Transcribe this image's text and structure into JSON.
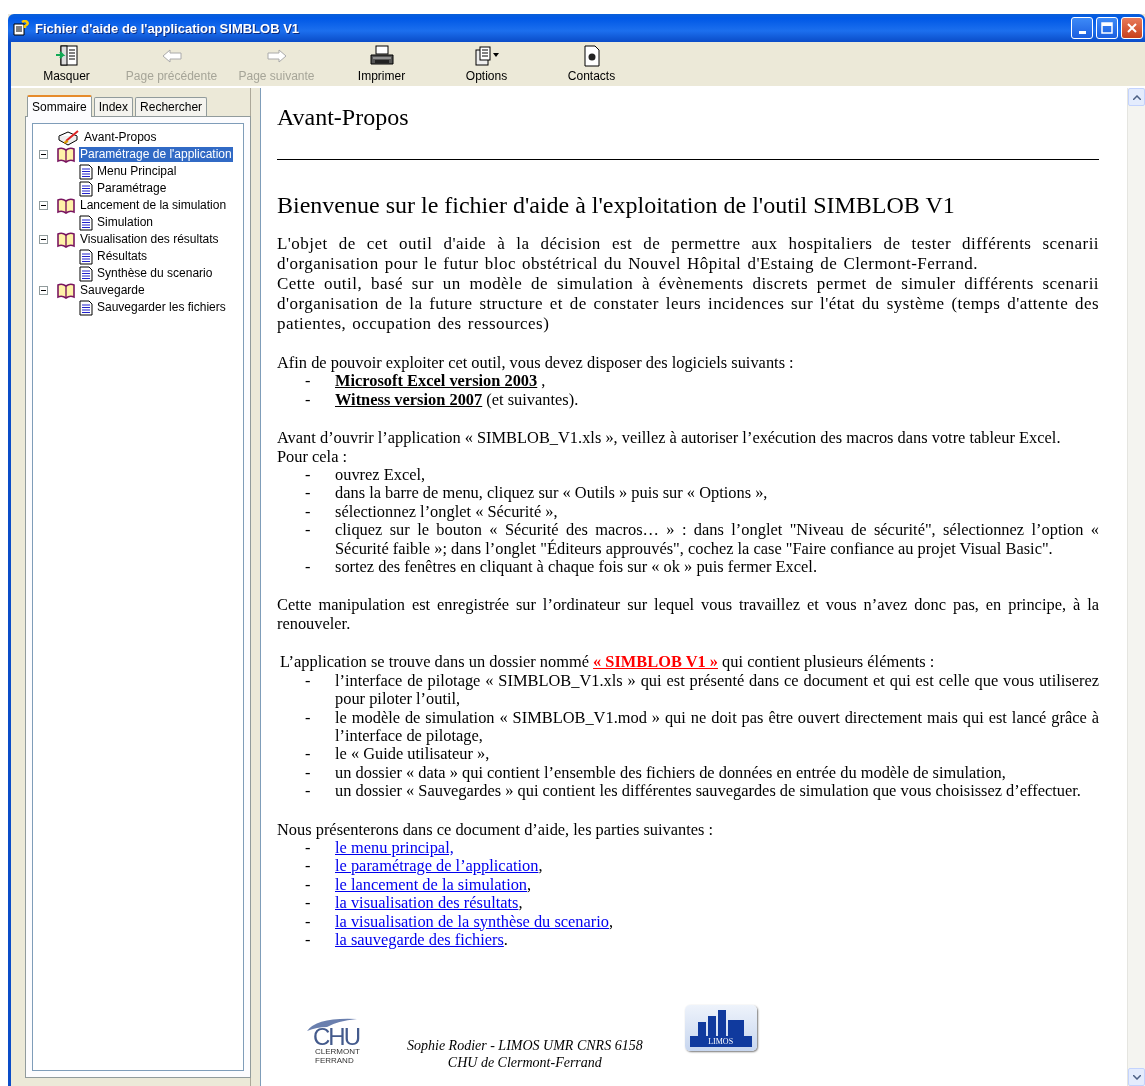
{
  "window": {
    "title": "Fichier d'aide de l'application SIMBLOB V1"
  },
  "toolbar": [
    {
      "label": "Masquer",
      "disabled": false
    },
    {
      "label": "Page précédente",
      "disabled": true
    },
    {
      "label": "Page suivante",
      "disabled": true
    },
    {
      "label": "Imprimer",
      "disabled": false
    },
    {
      "label": "Options",
      "disabled": false
    },
    {
      "label": "Contacts",
      "disabled": false
    }
  ],
  "sidebar": {
    "tabs": [
      {
        "label": "Sommaire",
        "selected": true
      },
      {
        "label": "Index",
        "selected": false
      },
      {
        "label": "Rechercher",
        "selected": false
      }
    ],
    "tree": [
      {
        "label": "Avant-Propos",
        "kind": "note",
        "selected": false
      },
      {
        "label": "Paramétrage de l'application",
        "kind": "book",
        "expanded": true,
        "selected": true,
        "children": [
          {
            "label": "Menu Principal",
            "kind": "page",
            "selected": false
          },
          {
            "label": "Paramétrage",
            "kind": "page",
            "selected": false
          }
        ]
      },
      {
        "label": "Lancement de la simulation",
        "kind": "book",
        "expanded": true,
        "selected": false,
        "children": [
          {
            "label": "Simulation",
            "kind": "page",
            "selected": false
          }
        ]
      },
      {
        "label": "Visualisation des résultats",
        "kind": "book",
        "expanded": true,
        "selected": false,
        "children": [
          {
            "label": "Résultats",
            "kind": "page",
            "selected": false
          },
          {
            "label": "Synthèse du scenario",
            "kind": "page",
            "selected": false
          }
        ]
      },
      {
        "label": "Sauvegarde",
        "kind": "book",
        "expanded": true,
        "selected": false,
        "children": [
          {
            "label": "Sauvegarder les fichiers",
            "kind": "page",
            "selected": false
          }
        ]
      }
    ]
  },
  "content": {
    "heading": "Avant-Propos",
    "title": "Bienvenue sur le fichier d'aide à l'exploitation de l'outil SIMBLOB V1",
    "sections": [
      [
        {
          "kind": "intro",
          "text": "L'objet de cet outil d'aide à la décision est de permettre aux hospitaliers de tester différents scenarii d'organisation pour le futur bloc obstétrical du Nouvel Hôpital d'Estaing de Clermont-Ferrand."
        },
        {
          "kind": "intro",
          "text": "Cette outil, basé sur un modèle de simulation à évènements discrets permet de simuler différents scenarii d'organisation de la future structure et de constater leurs incidences sur l'état du système (temps d'attente des patientes, occupation des ressources)"
        }
      ],
      [
        {
          "kind": "paragraph",
          "text": "Afin de pouvoir exploiter cet outil, vous devez disposer des logiciels suivants :"
        },
        {
          "kind": "bullet",
          "marker": "-",
          "text": "**Microsoft Excel version 2003** ,"
        },
        {
          "kind": "bullet",
          "marker": "-",
          "text": "**Witness version 2007** (et suivantes)."
        }
      ],
      [
        {
          "kind": "paragraph",
          "text": "Avant d’ouvrir l’application « SIMBLOB_V1.xls », veillez à autoriser l’exécution des macros dans votre tableur Excel."
        },
        {
          "kind": "paragraph",
          "text": "Pour cela :"
        },
        {
          "kind": "bullet",
          "marker": "-",
          "text": "ouvrez Excel,"
        },
        {
          "kind": "bullet",
          "marker": "-",
          "text": "dans la barre de menu, cliquez sur « Outils » puis sur « Options »,"
        },
        {
          "kind": "bullet",
          "marker": "-",
          "text": "sélectionnez l’onglet « Sécurité »,"
        },
        {
          "kind": "bullet",
          "marker": "-",
          "text": "cliquez sur le bouton « Sécurité des macros… » : dans l’onglet \"Niveau de sécurité\", sélectionnez l’option « Sécurité faible »; dans l’onglet \"Éditeurs approuvés\", cochez la case \"Faire confiance au projet Visual Basic\"."
        },
        {
          "kind": "bullet",
          "marker": "-",
          "text": "sortez des fenêtres en cliquant à chaque fois sur « ok » puis fermer Excel."
        }
      ],
      [
        {
          "kind": "paragraph",
          "text": "Cette manipulation est enregistrée sur l’ordinateur sur lequel vous travaillez et vous n’avez donc pas, en principe, à la renouveler."
        }
      ],
      [
        {
          "kind": "link_paragraph",
          "before": "L’application se trouve dans un dossier nommé",
          "link": "« SIMBLOB V1 »",
          "after": "qui contient plusieurs éléments :"
        },
        {
          "kind": "bullet",
          "marker": "-",
          "text": "l’interface de pilotage « SIMBLOB_V1.xls » qui est présenté dans ce document et qui est celle que vous utiliserez pour piloter l’outil,"
        },
        {
          "kind": "bullet",
          "marker": "-",
          "text": "le modèle de simulation « SIMBLOB_V1.mod » qui ne doit pas être ouvert directement mais qui est lancé grâce à l’interface de pilotage,"
        },
        {
          "kind": "bullet",
          "marker": "-",
          "text": "le « Guide utilisateur »,"
        },
        {
          "kind": "bullet",
          "marker": "-",
          "text": "un dossier « data » qui contient l’ensemble des fichiers de données en entrée du modèle de simulation,"
        },
        {
          "kind": "bullet",
          "marker": "-",
          "text": "un dossier « Sauvegardes » qui contient les différentes sauvegardes de simulation que vous choisissez d’effectuer."
        }
      ],
      [
        {
          "kind": "paragraph",
          "text": "Nous présenterons dans ce document d’aide, les parties suivantes :"
        },
        {
          "kind": "link_bullet",
          "marker": "-",
          "link": "le menu principal,"
        },
        {
          "kind": "link_bullet",
          "marker": "-",
          "link": "le paramétrage de l’application",
          "after": ","
        },
        {
          "kind": "link_bullet",
          "marker": "-",
          "link": "le lancement de la simulation",
          "after": ","
        },
        {
          "kind": "link_bullet",
          "marker": "-",
          "link": "la visualisation des résultats",
          "after": ","
        },
        {
          "kind": "link_bullet",
          "marker": "-",
          "link": "la visualisation de la synthèse du scenario",
          "after": ","
        },
        {
          "kind": "link_bullet",
          "marker": "-",
          "link": "la sauvegarde des fichiers",
          "after": "."
        }
      ]
    ],
    "footer": {
      "chu_logo": {
        "text": "CHU",
        "subtitle": [
          "CLERMONT",
          "FERRAND"
        ]
      },
      "author": [
        "Sophie Rodier - LIMOS UMR CNRS 6158",
        "CHU de Clermont-Ferrand"
      ],
      "limos_logo": {
        "text": "LIMOS"
      }
    }
  }
}
